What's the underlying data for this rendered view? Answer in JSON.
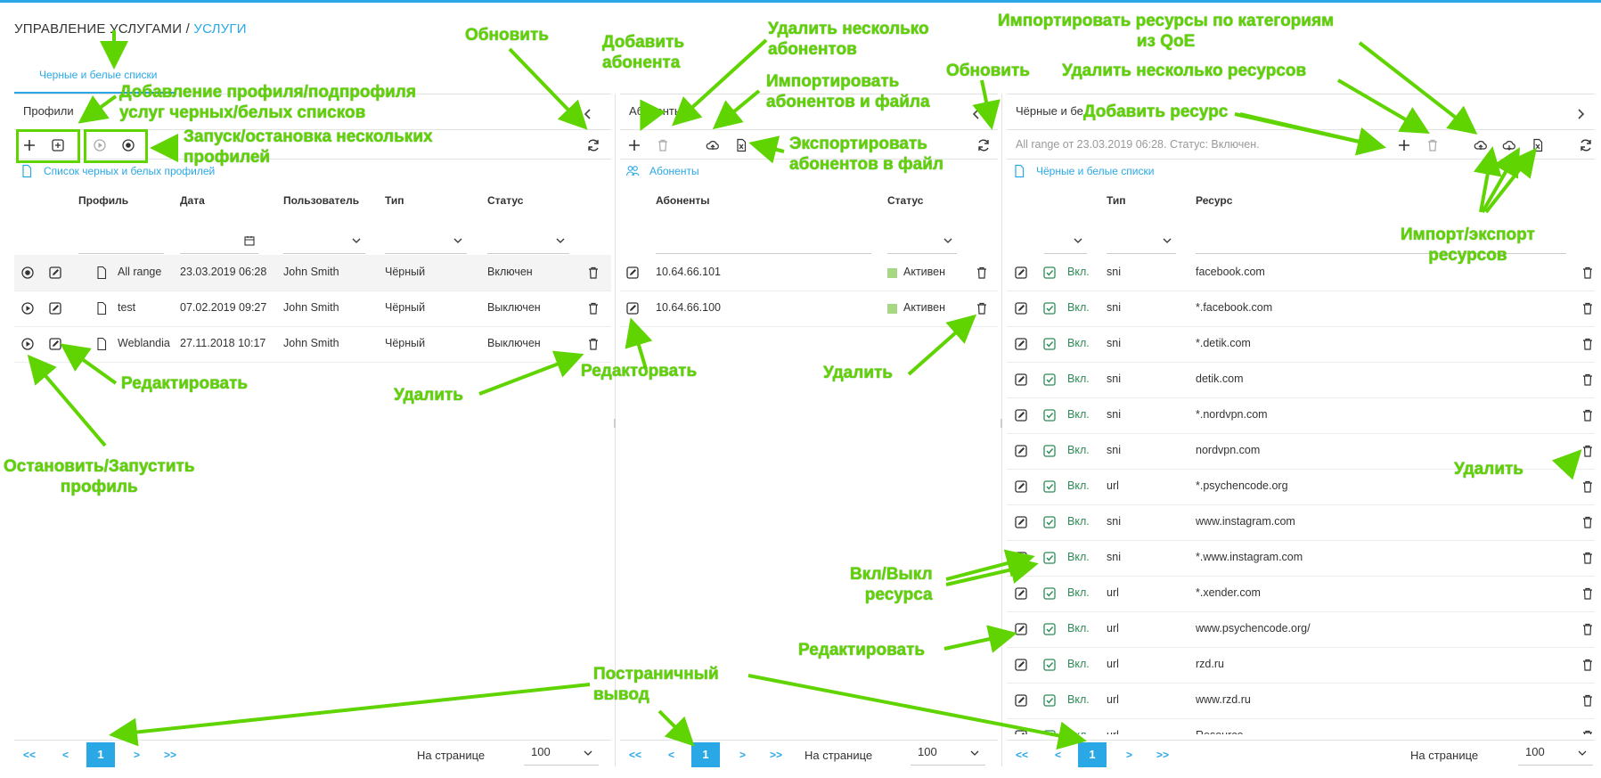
{
  "breadcrumb": {
    "root": "УПРАВЛЕНИЕ УСЛУГАМИ",
    "sep": " / ",
    "current": "УСЛУГИ"
  },
  "main_tab": "Черные и белые списки",
  "profiles_panel": {
    "title": "Профили",
    "list_link": "Список черных и белых профилей",
    "columns": [
      "Профиль",
      "Дата",
      "Пользователь",
      "Тип",
      "Статус"
    ],
    "rows": [
      {
        "name": "All range",
        "date": "23.03.2019 06:28",
        "user": "John Smith",
        "type": "Чёрный",
        "status": "Включен"
      },
      {
        "name": "test",
        "date": "07.02.2019 09:27",
        "user": "John Smith",
        "type": "Чёрный",
        "status": "Выключен"
      },
      {
        "name": "Weblandia",
        "date": "27.11.2018 10:17",
        "user": "John Smith",
        "type": "Чёрный",
        "status": "Выключен"
      }
    ],
    "pager": {
      "first": "<<",
      "prev": "<",
      "current": "1",
      "next": ">",
      "last": ">>",
      "per_page_label": "На странице",
      "per_page": "100"
    }
  },
  "subscribers_panel": {
    "title": "Абоненты",
    "list_link": "Абоненты",
    "columns": [
      "Абоненты",
      "Статус"
    ],
    "rows": [
      {
        "ip": "10.64.66.101",
        "status": "Активен"
      },
      {
        "ip": "10.64.66.100",
        "status": "Активен"
      }
    ],
    "pager": {
      "first": "<<",
      "prev": "<",
      "current": "1",
      "next": ">",
      "last": ">>",
      "per_page_label": "На странице",
      "per_page": "100"
    }
  },
  "resources_panel": {
    "title": "Чёрные и бе",
    "info": "All range от 23.03.2019 06:28. Статус: Включен.",
    "list_link": "Чёрные и белые списки",
    "columns": [
      "Тип",
      "Ресурс"
    ],
    "rows": [
      {
        "state": "Вкл.",
        "type": "sni",
        "resource": "facebook.com"
      },
      {
        "state": "Вкл.",
        "type": "sni",
        "resource": "*.facebook.com"
      },
      {
        "state": "Вкл.",
        "type": "sni",
        "resource": "*.detik.com"
      },
      {
        "state": "Вкл.",
        "type": "sni",
        "resource": "detik.com"
      },
      {
        "state": "Вкл.",
        "type": "sni",
        "resource": "*.nordvpn.com"
      },
      {
        "state": "Вкл.",
        "type": "sni",
        "resource": "nordvpn.com"
      },
      {
        "state": "Вкл.",
        "type": "url",
        "resource": "*.psychencode.org"
      },
      {
        "state": "Вкл.",
        "type": "sni",
        "resource": "www.instagram.com"
      },
      {
        "state": "Вкл.",
        "type": "sni",
        "resource": "*.www.instagram.com"
      },
      {
        "state": "Вкл.",
        "type": "url",
        "resource": "*.xender.com"
      },
      {
        "state": "Вкл.",
        "type": "url",
        "resource": "www.psychencode.org/"
      },
      {
        "state": "Вкл.",
        "type": "url",
        "resource": "rzd.ru"
      },
      {
        "state": "Вкл.",
        "type": "url",
        "resource": "www.rzd.ru"
      },
      {
        "state": "Вкл.",
        "type": "url",
        "resource": "Resource"
      }
    ],
    "pager": {
      "first": "<<",
      "prev": "<",
      "current": "1",
      "next": ">",
      "last": ">>",
      "per_page_label": "На странице",
      "per_page": "100"
    }
  },
  "annotations": {
    "refresh_1": "Обновить",
    "add_profile": "Добавление профиля/подпрофиля\nуслуг черных/белых списков",
    "start_stop_many": "Запуск/остановка нескольких\nпрофилей",
    "edit_1": "Редактировать",
    "stop_start": "Остановить/Запустить\nпрофиль",
    "delete_1": "Удалить",
    "edit_2": "Редакторвать",
    "add_subscriber": "Добавить\nабонента",
    "delete_many_subs": "Удалить несколько\nабонентов",
    "import_subs": "Импортировать\nабонентов и файла",
    "export_subs": "Экспортировать\nабонентов в файл",
    "refresh_2": "Обновить",
    "delete_2": "Удалить",
    "import_qoe": "Импортировать ресурсы по категориям\nиз QoE",
    "delete_many_res": "Удалить несколько ресурсов",
    "add_resource": "Добавить ресурс",
    "import_export_res": "Импорт/экспорт\nресурсов",
    "delete_3": "Удалить",
    "toggle_res": "Вкл/Выкл\nресурса",
    "edit_3": "Редактировать",
    "paging": "Постраничный\nвывод"
  },
  "colors": {
    "accent": "#2aa8e6",
    "annotation": "#5fd400",
    "active": "#a6d785",
    "enabled_text": "#2e8b57"
  }
}
